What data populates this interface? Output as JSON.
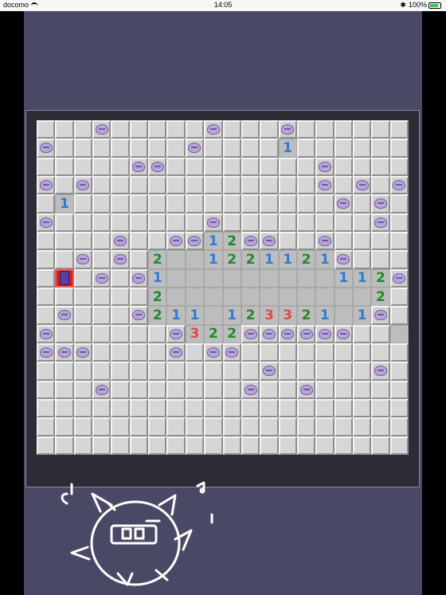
{
  "status_bar": {
    "carrier": "docomo",
    "time": "14:05",
    "battery": "100%"
  },
  "colors": {
    "app_bg": "#4a4965",
    "n1": "#2a7cd6",
    "n2": "#1f8a2c",
    "n3": "#e0474c"
  },
  "board": {
    "cols": 20,
    "rows": 18,
    "rows_data": [
      "CCCFCCCCCFCCCFCCCCCC",
      "FCCCCCCCFCCCC1CCCCCC",
      "CCCCCFFCCCCCCCCFCCCC",
      "FCFCCCCCCCCCCCCFCFCF",
      "C1CCCCCCCCCCCCCCFCFC",
      "FCCCCCCCCFCCCCCCCCFC",
      "CCCCFCCFF12FFCCFCCCC",
      "CCFCFC2..1221121FCCC",
      "CRCFCF1.........112F",
      "CCCCCC2...........2C",
      "CFCCCF211.123321.1FC",
      "FCCCCCCF322FFFFFFCC.",
      "FFFCCCCFCFFCCCCCCCCC",
      "CCCCCCCCCCCCFCCCCCFC",
      "CCCFCCCCCCCFCCFCCCCC",
      "CCCCCCCCCCCCCCCCCCCC",
      "CCCCCCCCCCCCCCCCCCCC",
      "CCCCCCCCCCCCCCCCCCCC"
    ]
  }
}
